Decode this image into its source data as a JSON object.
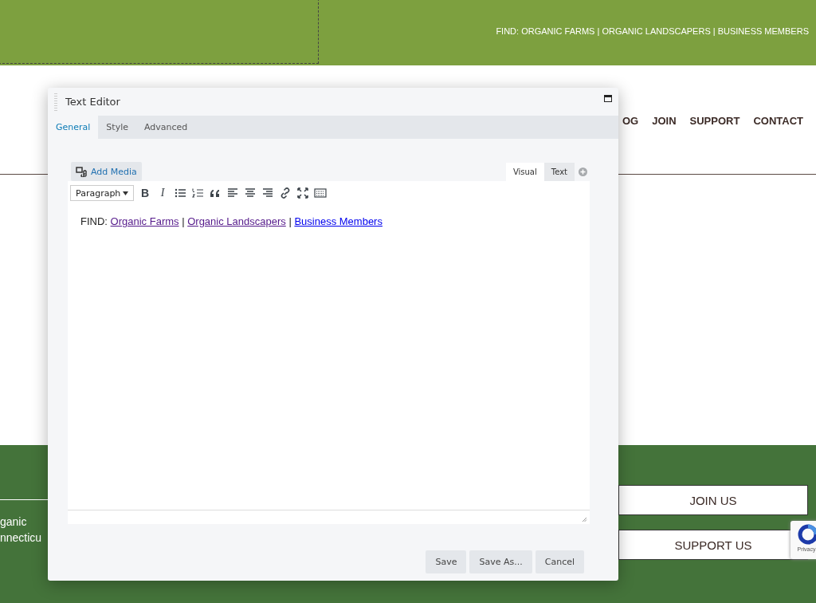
{
  "header": {
    "find_text": "FIND: ORGANIC FARMS | ORGANIC LANDSCAPERS | BUSINESS MEMBERS"
  },
  "nav": [
    {
      "label": "OG"
    },
    {
      "label": "JOIN"
    },
    {
      "label": "SUPPORT"
    },
    {
      "label": "CONTACT"
    }
  ],
  "footer": {
    "text_lines": [
      "ganic",
      "nnecticu"
    ],
    "buttons": [
      "JOIN US",
      "SUPPORT US"
    ],
    "recaptcha": "Privacy"
  },
  "modal": {
    "title": "Text Editor",
    "tabs": [
      {
        "label": "General",
        "selected": true
      },
      {
        "label": "Style",
        "selected": false
      },
      {
        "label": "Advanced",
        "selected": false
      }
    ],
    "add_media": "Add Media",
    "editor_tabs": [
      {
        "label": "Visual",
        "selected": true
      },
      {
        "label": "Text",
        "selected": false
      }
    ],
    "format": "Paragraph",
    "toolbar": [
      {
        "kind": "bold",
        "glyph": "B"
      },
      {
        "kind": "italic",
        "glyph": "I"
      },
      {
        "kind": "bullets"
      },
      {
        "kind": "numbers"
      },
      {
        "kind": "quote"
      },
      {
        "kind": "align-left"
      },
      {
        "kind": "align-center"
      },
      {
        "kind": "align-right"
      },
      {
        "kind": "link"
      },
      {
        "kind": "fullscreen"
      },
      {
        "kind": "keyboard"
      }
    ],
    "content": [
      {
        "kind": "text",
        "text": "FIND:"
      },
      {
        "kind": "link",
        "text": "Organic Farms",
        "visited": true
      },
      {
        "kind": "text",
        "text": "|"
      },
      {
        "kind": "link",
        "text": "Organic Landscapers",
        "visited": true
      },
      {
        "kind": "text",
        "text": "|"
      },
      {
        "kind": "link",
        "text": "Business Members",
        "visited": false
      }
    ],
    "buttons": [
      "Save",
      "Save As...",
      "Cancel"
    ]
  }
}
